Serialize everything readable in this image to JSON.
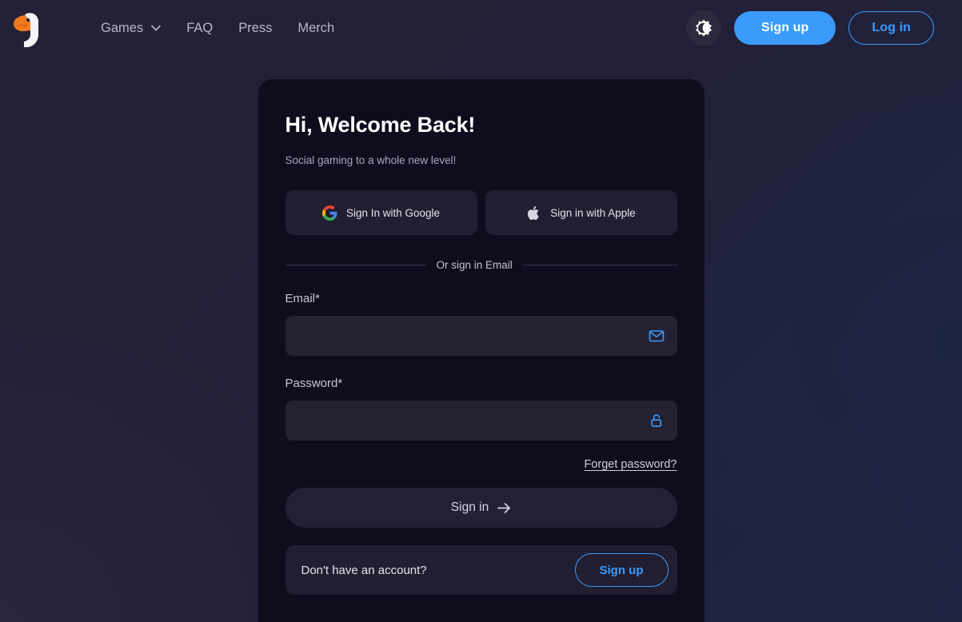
{
  "header": {
    "logo_icon": "goose-logo-icon",
    "nav": [
      {
        "label": "Games",
        "has_dropdown": true,
        "icon": "chevron-down-icon"
      },
      {
        "label": "FAQ",
        "has_dropdown": false
      },
      {
        "label": "Press",
        "has_dropdown": false
      },
      {
        "label": "Merch",
        "has_dropdown": false
      }
    ],
    "theme_toggle_icon": "sun-moon-icon",
    "signup_label": "Sign up",
    "login_label": "Log in"
  },
  "card": {
    "title": "Hi, Welcome Back!",
    "subtitle": "Social gaming to a whole new level!",
    "social": [
      {
        "label": "Sign In with Google",
        "icon": "google-icon"
      },
      {
        "label": "Sign in with Apple",
        "icon": "apple-icon"
      }
    ],
    "divider_label": "Or sign in Email",
    "email": {
      "label": "Email*",
      "value": "",
      "placeholder": "",
      "icon": "envelope-icon"
    },
    "password": {
      "label": "Password*",
      "value": "",
      "placeholder": "",
      "icon": "unlocked-padlock-icon"
    },
    "forgot_label": "Forget password?",
    "signin_label": "Sign in",
    "signin_icon": "arrow-right-icon",
    "signup_prompt": "Don't have an account?",
    "signup_label": "Sign up"
  },
  "colors": {
    "accent_blue": "#3b9bfb",
    "page_bg": "#242036",
    "card_bg": "#110b1e",
    "input_bg": "#242133",
    "logo_orange": "#f07c22"
  }
}
